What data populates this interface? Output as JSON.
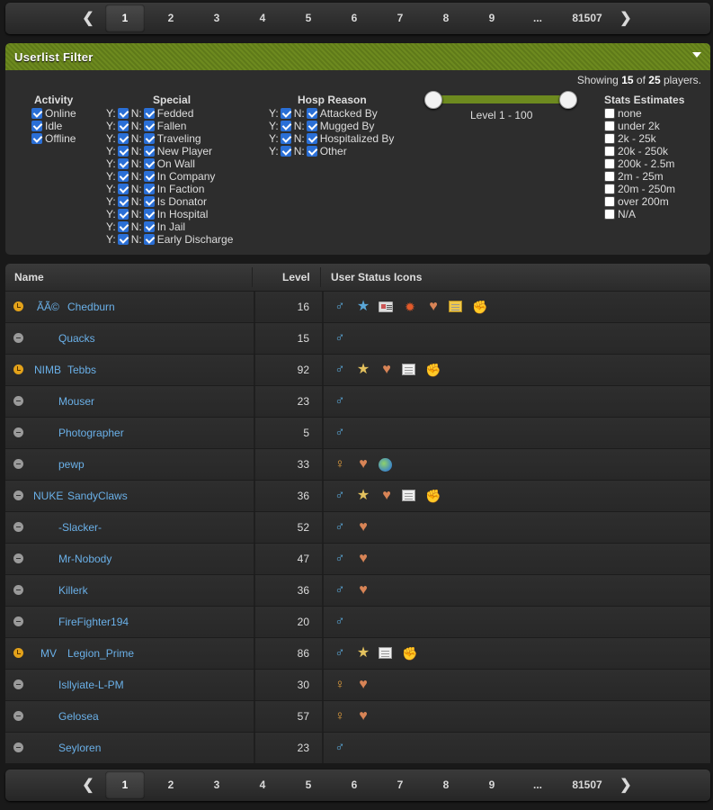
{
  "pagination": {
    "prev": "❮",
    "next": "❯",
    "pages": [
      "1",
      "2",
      "3",
      "4",
      "5",
      "6",
      "7",
      "8",
      "9",
      "...",
      "81507"
    ],
    "current": "1"
  },
  "filter": {
    "title": "Userlist Filter",
    "showing_prefix": "Showing",
    "showing_count": "15",
    "showing_of": "of",
    "showing_total": "25",
    "showing_suffix": "players.",
    "activity": {
      "title": "Activity",
      "items": [
        "Online",
        "Idle",
        "Offline"
      ]
    },
    "special": {
      "title": "Special",
      "y": "Y:",
      "n": "N:",
      "items": [
        "Fedded",
        "Fallen",
        "Traveling",
        "New Player",
        "On Wall",
        "In Company",
        "In Faction",
        "Is Donator",
        "In Hospital",
        "In Jail",
        "Early Discharge"
      ]
    },
    "hosp": {
      "title": "Hosp Reason",
      "y": "Y:",
      "n": "N:",
      "items": [
        "Attacked By",
        "Mugged By",
        "Hospitalized By",
        "Other"
      ]
    },
    "level": {
      "label": "Level 1 - 100",
      "min": 1,
      "max": 100
    },
    "stats": {
      "title": "Stats Estimates",
      "items": [
        "none",
        "under 2k",
        "2k - 25k",
        "20k - 250k",
        "200k - 2.5m",
        "2m - 25m",
        "20m - 250m",
        "over 200m",
        "N/A"
      ]
    }
  },
  "table": {
    "headers": {
      "name": "Name",
      "level": "Level",
      "icons": "User Status Icons"
    },
    "rows": [
      {
        "status": "idle",
        "faction": "ÃÃ©",
        "name": "Chedburn",
        "level": "16",
        "icons": [
          "male",
          "star-blue",
          "card",
          "burst",
          "heart",
          "note-gold",
          "fist-gold"
        ]
      },
      {
        "status": "offline",
        "faction": "",
        "name": "Quacks",
        "level": "15",
        "icons": [
          "male"
        ]
      },
      {
        "status": "idle",
        "faction": "NIMB",
        "name": "Tebbs",
        "level": "92",
        "icons": [
          "male",
          "star-gold",
          "heart",
          "note",
          "fist"
        ]
      },
      {
        "status": "offline",
        "faction": "",
        "name": "Mouser",
        "level": "23",
        "icons": [
          "male"
        ]
      },
      {
        "status": "offline",
        "faction": "",
        "name": "Photographer",
        "level": "5",
        "icons": [
          "male"
        ]
      },
      {
        "status": "offline",
        "faction": "",
        "name": "pewp",
        "level": "33",
        "icons": [
          "female",
          "heart",
          "globe"
        ]
      },
      {
        "status": "offline",
        "faction": "NUKE",
        "name": "SandyClaws",
        "level": "36",
        "icons": [
          "male",
          "star-gold",
          "heart",
          "note",
          "fist"
        ]
      },
      {
        "status": "offline",
        "faction": "",
        "name": "-Slacker-",
        "level": "52",
        "icons": [
          "male",
          "heart"
        ]
      },
      {
        "status": "offline",
        "faction": "",
        "name": "Mr-Nobody",
        "level": "47",
        "icons": [
          "male",
          "heart"
        ]
      },
      {
        "status": "offline",
        "faction": "",
        "name": "Killerk",
        "level": "36",
        "icons": [
          "male",
          "heart"
        ]
      },
      {
        "status": "offline",
        "faction": "",
        "name": "FireFighter194",
        "level": "20",
        "icons": [
          "male"
        ]
      },
      {
        "status": "idle",
        "faction": "MV",
        "name": "Legion_Prime",
        "level": "86",
        "icons": [
          "male",
          "star-gold",
          "note",
          "fist"
        ]
      },
      {
        "status": "offline",
        "faction": "",
        "name": "Isllyiate-L-PM",
        "level": "30",
        "icons": [
          "female",
          "heart"
        ]
      },
      {
        "status": "offline",
        "faction": "",
        "name": "Gelosea",
        "level": "57",
        "icons": [
          "female",
          "heart"
        ]
      },
      {
        "status": "offline",
        "faction": "",
        "name": "Seyloren",
        "level": "23",
        "icons": [
          "male"
        ]
      }
    ]
  }
}
